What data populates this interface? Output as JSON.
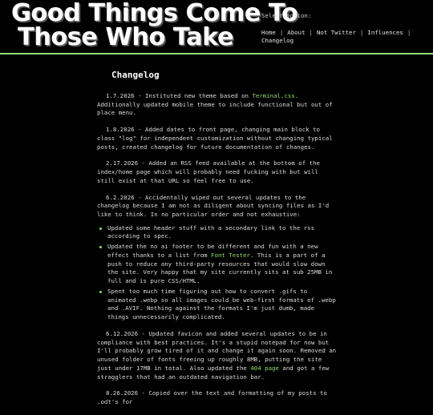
{
  "header": {
    "logo_line1": "Good Things Come To",
    "logo_line2": "Those Who Take",
    "select_label": "Select option:",
    "nav": [
      "Home",
      "About",
      "Not Twitter",
      "Influences",
      "Changelog"
    ]
  },
  "main": {
    "title": "Changelog",
    "entries": [
      {
        "pre": "1.7.2026 - Instituted new theme based on ",
        "link": "Terminal.css",
        "post": ". Additionally updated mobile theme to include functional but out of place menu."
      },
      {
        "text": "1.8.2026 - Added dates to front page, changing main block to class \"log\" for independent customization without changing typical posts, created changelog for future documentation of changes."
      },
      {
        "text": "2.17.2026 - Added an RSS feed available at the bottom of the index/home page which will probably need fucking with but will still exist at that URL so feel free to use."
      },
      {
        "text": "6.2.2026 - Accidentally wiped out several updates to the changelog because I am not as diligent about syncing files as I'd like to think. In no particular order and not exhaustive:"
      },
      {
        "text": "6.12.2026 - Updated favicon and added several updates to be in compliance with best practices. It's a stupid notepad for now but I'll probably grow tired of it and change it again soon. Removed an unused folder of fonts freeing up roughly 8MB, putting the site just under 17MB in total. Also updated the ",
        "link": "404 page",
        "post": " and got a few stragglers that had an outdated navigation bar."
      },
      {
        "text": "8.26.2026 - Copied over the text and formatting of my posts to .odt's for"
      }
    ],
    "bullets": [
      {
        "text": "Updated some header stuff with a secondary link to the rss according to spec."
      },
      {
        "pre": "Updated the no ai footer to be different and fun with a new effect thanks to a list from ",
        "link": "Font Tester",
        "post": ". This is a part of a push to reduce any third-party resources that would slow down the site. Very happy that my site currently sits at sub 25MB in full and is pure CSS/HTML."
      },
      {
        "text": "Spent too much time figuring out how to convert .gifs to animated .webp so all images could be web-first formats of .webp and .AVIF. Nothing against the formats I'm just dumb, made things unnecessarily complicated."
      }
    ]
  }
}
